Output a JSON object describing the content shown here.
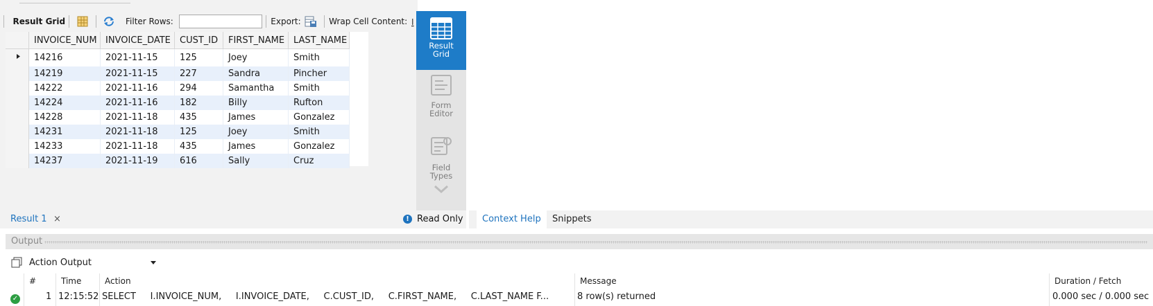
{
  "toolbar": {
    "result_grid_label": "Result Grid",
    "filter_label": "Filter Rows:",
    "filter_value": "",
    "export_label": "Export:",
    "wrap_label": "Wrap Cell Content:"
  },
  "grid": {
    "columns": [
      "INVOICE_NUM",
      "INVOICE_DATE",
      "CUST_ID",
      "FIRST_NAME",
      "LAST_NAME"
    ],
    "rows": [
      [
        "14216",
        "2021-11-15",
        "125",
        "Joey",
        "Smith"
      ],
      [
        "14219",
        "2021-11-15",
        "227",
        "Sandra",
        "Pincher"
      ],
      [
        "14222",
        "2021-11-16",
        "294",
        "Samantha",
        "Smith"
      ],
      [
        "14224",
        "2021-11-16",
        "182",
        "Billy",
        "Rufton"
      ],
      [
        "14228",
        "2021-11-18",
        "435",
        "James",
        "Gonzalez"
      ],
      [
        "14231",
        "2021-11-18",
        "125",
        "Joey",
        "Smith"
      ],
      [
        "14233",
        "2021-11-18",
        "435",
        "James",
        "Gonzalez"
      ],
      [
        "14237",
        "2021-11-19",
        "616",
        "Sally",
        "Cruz"
      ]
    ]
  },
  "side_panel": {
    "result_grid": [
      "Result",
      "Grid"
    ],
    "form_editor": [
      "Form",
      "Editor"
    ],
    "field_types": [
      "Field",
      "Types"
    ]
  },
  "result_tabs": {
    "result_tab": "Result 1",
    "close": "×",
    "read_only": "Read Only"
  },
  "help_tabs": {
    "context_help": "Context Help",
    "snippets": "Snippets"
  },
  "output": {
    "title": "Output",
    "action_select": "Action Output",
    "columns": {
      "num": "#",
      "time": "Time",
      "action": "Action",
      "message": "Message",
      "duration": "Duration / Fetch"
    },
    "row": {
      "num": "1",
      "time": "12:15:52",
      "action": "SELECT     I.INVOICE_NUM,     I.INVOICE_DATE,     C.CUST_ID,     C.FIRST_NAME,     C.LAST_NAME F...",
      "message": "8 row(s) returned",
      "duration": "0.000 sec / 0.000 sec"
    }
  },
  "colors": {
    "accent": "#1e7cc8",
    "link": "#1e73be",
    "row_alt": "#e8f0fb",
    "success": "#2e9e43"
  }
}
